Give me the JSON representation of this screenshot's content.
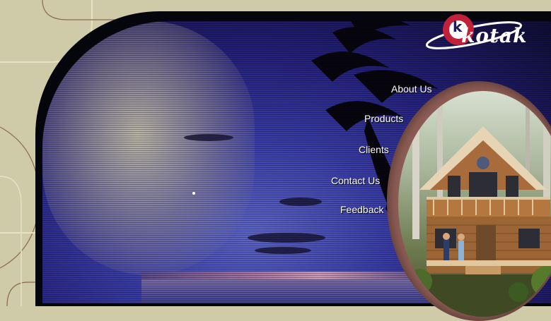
{
  "brand": {
    "name": "kotak",
    "mark": "k"
  },
  "nav": {
    "items": [
      {
        "id": "about",
        "label": "About Us"
      },
      {
        "id": "products",
        "label": "Products"
      },
      {
        "id": "clients",
        "label": "Clients"
      },
      {
        "id": "contact",
        "label": "Contact Us"
      },
      {
        "id": "feedback",
        "label": "Feedback"
      }
    ]
  },
  "colors": {
    "page_background": "#cfcaa8",
    "frame": "#05060c",
    "sky": "#3b3ea8",
    "oval_frame": "#8f5e56",
    "logo_ring": "#c2213a",
    "nav_text": "#ffffff"
  },
  "images": {
    "sunset": "sunset-palm-photo",
    "cabin": "log-cabin-photo"
  }
}
